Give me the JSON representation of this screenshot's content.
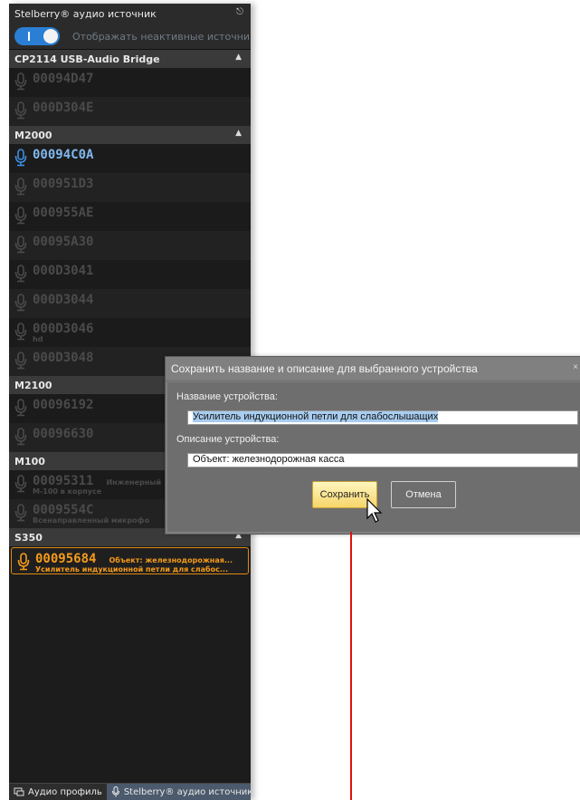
{
  "panel": {
    "title": "Stelberry® аудио источник",
    "pin_icon": "pin-icon",
    "toggle_label": "Отображать неактивные источники",
    "groups": [
      {
        "name": "CP2114 USB-Audio Bridge",
        "devices": [
          {
            "id": "00094D47",
            "desc": "",
            "sub": "",
            "state": "inactive"
          },
          {
            "id": "000D304E",
            "desc": "",
            "sub": "",
            "state": "inactive"
          }
        ]
      },
      {
        "name": "M2000",
        "devices": [
          {
            "id": "00094C0A",
            "desc": "",
            "sub": "",
            "state": "active"
          },
          {
            "id": "000951D3",
            "desc": "",
            "sub": "",
            "state": "inactive"
          },
          {
            "id": "000955AE",
            "desc": "",
            "sub": "",
            "state": "inactive"
          },
          {
            "id": "00095A30",
            "desc": "",
            "sub": "",
            "state": "inactive"
          },
          {
            "id": "000D3041",
            "desc": "",
            "sub": "",
            "state": "inactive"
          },
          {
            "id": "000D3044",
            "desc": "",
            "sub": "",
            "state": "inactive"
          },
          {
            "id": "000D3046",
            "desc": "",
            "sub": "hd",
            "state": "inactive"
          },
          {
            "id": "000D3048",
            "desc": "",
            "sub": "",
            "state": "inactive"
          }
        ]
      },
      {
        "name": "M2100",
        "devices": [
          {
            "id": "00096192",
            "desc": "",
            "sub": "",
            "state": "inactive"
          },
          {
            "id": "00096630",
            "desc": "",
            "sub": "",
            "state": "inactive"
          }
        ]
      },
      {
        "name": "M100",
        "devices": [
          {
            "id": "00095311",
            "desc": "Инженерный",
            "sub": "M-100 в корпусе",
            "state": "inactive"
          },
          {
            "id": "0009554C",
            "desc": "",
            "sub": "Всенаправленный микрофо",
            "state": "inactive"
          }
        ]
      },
      {
        "name": "S350",
        "devices": [
          {
            "id": "00095684",
            "desc": "Объект: железнодорожная...",
            "sub": "Усилитель индукционной петли для слабос...",
            "state": "selected"
          }
        ]
      }
    ],
    "tabs": [
      {
        "label": "Аудио профиль",
        "icon": "audio-profile-icon"
      },
      {
        "label": "Stelberry® аудио источник",
        "icon": "microphone-icon"
      }
    ]
  },
  "dialog": {
    "title": "Сохранить название и описание для выбранного устройства",
    "name_label": "Название устройства:",
    "name_value": "Усилитель индукционной петли для слабослышащих",
    "desc_label": "Описание устройства:",
    "desc_value": "Объект: железнодорожная касса",
    "save_label": "Сохранить",
    "cancel_label": "Отмена"
  },
  "colors": {
    "accent_blue": "#2a7fd4",
    "selected_orange": "#f59b1a",
    "annotation_red": "#e01010"
  }
}
